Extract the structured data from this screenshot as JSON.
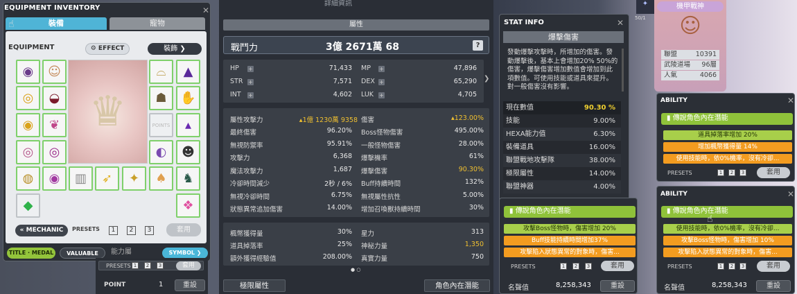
{
  "equip": {
    "title": "EQUIPMENT INVENTORY",
    "tab_equip": "裝備",
    "tab_pet": "寵物",
    "label": "EQUIPMENT",
    "effect": "EFFECT",
    "decoration": "裝飾",
    "mechanic": "MECHANIC",
    "presets_label": "PRESETS",
    "presets": [
      "1",
      "2",
      "3"
    ],
    "apply": "套用",
    "title_medal": "TITLE · MEDAL",
    "valuable": "VALUABLE",
    "symbol": "SYMBOL",
    "point_label": "POINT",
    "point_value": "1",
    "reset": "重設",
    "ability_fragment": "能力屬"
  },
  "stats": {
    "top_fragment": "詳細資訊",
    "section_title": "屬性",
    "power_label": "戰鬥力",
    "power_value": "3億 2671萬 68",
    "help": "?",
    "base": [
      {
        "k": "HP",
        "v": "71,433",
        "k2": "MP",
        "v2": "47,896"
      },
      {
        "k": "STR",
        "v": "7,571",
        "k2": "DEX",
        "v2": "65,290"
      },
      {
        "k": "INT",
        "v": "4,602",
        "k2": "LUK",
        "v2": "4,705"
      }
    ],
    "attack_label": "屬性攻擊力",
    "attack_value": "1億 1230萬 9358",
    "damage_label": "傷害",
    "damage_value": "123.00%",
    "rows": [
      {
        "k": "最終傷害",
        "v": "96.20%",
        "k2": "Boss怪物傷害",
        "v2": "495.00%"
      },
      {
        "k": "無視防禦率",
        "v": "95.91%",
        "k2": "一般怪物傷害",
        "v2": "28.00%"
      },
      {
        "k": "攻擊力",
        "v": "6,368",
        "k2": "爆擊機率",
        "v2": "61%"
      },
      {
        "k": "魔法攻擊力",
        "v": "1,687",
        "k2": "爆擊傷害",
        "v2": "90.30%"
      },
      {
        "k": "冷卻時間減少",
        "v": "2秒 / 6%",
        "k2": "Buff持續時間",
        "v2": "132%"
      },
      {
        "k": "無視冷卻時間",
        "v": "6.75%",
        "k2": "無視屬性抗性",
        "v2": "5.00%"
      },
      {
        "k": "狀態異常追加傷害",
        "v": "14.00%",
        "k2": "增加召喚獸持續時間",
        "v2": "30%"
      }
    ],
    "extra": [
      {
        "k": "楓幣獲得量",
        "v": "30%",
        "k2": "星力",
        "v2": "313"
      },
      {
        "k": "道具掉落率",
        "v": "25%",
        "k2": "神秘力量",
        "v2": "1,350"
      },
      {
        "k": "額外獲得經驗值",
        "v": "208.00%",
        "k2": "真實力量",
        "v2": "750"
      }
    ],
    "btn_limit": "極限屬性",
    "btn_potential": "角色內在潛能"
  },
  "stat_info": {
    "title": "STAT INFO",
    "header": "爆擊傷害",
    "desc": "發動爆擊攻擊時，所增加的傷害。發動爆擊後，基本上會增加20% 50%的傷害，爆擊傷害增加數值會增加到此項數值。可使用技能或道具來提升。對一般傷害沒有影響。",
    "current_label": "現在數值",
    "current_value": "90.30 %",
    "rows": [
      {
        "k": "技能",
        "v": "9.00%"
      },
      {
        "k": "HEXA能力值",
        "v": "6.30%"
      },
      {
        "k": "裝備道具",
        "v": "16.00%"
      },
      {
        "k": "聯盟戰地攻擊隊",
        "v": "38.00%"
      },
      {
        "k": "極限屬性",
        "v": "14.00%"
      },
      {
        "k": "聯盟神器",
        "v": "4.00%"
      }
    ]
  },
  "inner_mid": {
    "title": "傳說角色內在潛能",
    "lines": [
      "攻擊Boss怪物時，傷害增加 20%",
      "Buff技能持續時間增加37%",
      "攻擊陷入狀態異常的對象時，傷害..."
    ],
    "presets_label": "PRESETS",
    "apply": "套用",
    "fame_label": "名聲值",
    "fame_value": "8,258,343",
    "reset": "重設"
  },
  "profile": {
    "name": "機甲戰神",
    "rows": [
      {
        "k": "聯盟",
        "v": "10391"
      },
      {
        "k": "武陵道場",
        "v": "96層"
      },
      {
        "k": "人氣",
        "v": "4066"
      }
    ],
    "level_fragment": "50/1"
  },
  "ability1": {
    "title": "ABILITY",
    "header": "傳說角色內在潛能",
    "lines": [
      "道具掉落率增加 20%",
      "增加楓幣獲得量 14%",
      "使用技能時，依0%機率，沒有冷卻..."
    ],
    "presets_label": "PRESETS",
    "apply": "套用"
  },
  "ability2": {
    "title": "ABILITY",
    "header": "傳說角色內在潛能",
    "lines": [
      "使用技能時，依0%機率，沒有冷卻...",
      "攻擊Boss怪物時，傷害增加 10%",
      "攻擊陷入狀態異常的對象時，傷害..."
    ],
    "presets_label": "PRESETS",
    "apply": "套用",
    "fame_label": "名聲值",
    "fame_value": "8,258,343",
    "reset": "重設"
  }
}
